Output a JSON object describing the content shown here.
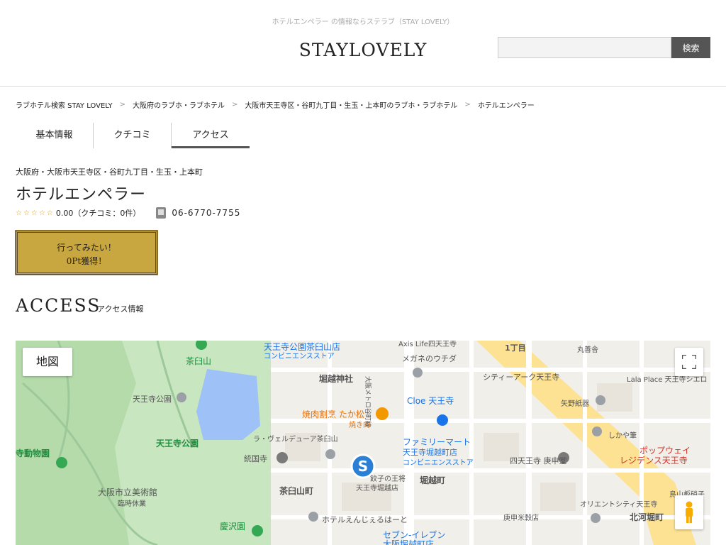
{
  "header": {
    "tagline": "ホテルエンペラー の情報ならステラブ（STAY LOVELY）",
    "logo_text": "STAYLOVELY",
    "search_placeholder": "",
    "search_button": "検索"
  },
  "breadcrumb": [
    "ラブホテル検索 STAY LOVELY",
    "大阪府のラブホ・ラブホテル",
    "大阪市天王寺区・谷町九丁目・生玉・上本町のラブホ・ラブホテル",
    "ホテルエンペラー"
  ],
  "tabs": [
    {
      "label": "基本情報",
      "active": false
    },
    {
      "label": "クチコミ",
      "active": false
    },
    {
      "label": "アクセス",
      "active": true
    }
  ],
  "hotel": {
    "area": "大阪府・大阪市天王寺区・谷町九丁目・生玉・上本町",
    "name": "ホテルエンペラー",
    "stars": "☆☆☆☆☆",
    "rating_text": "0.00（クチコミ：0件）",
    "phone": "06-6770-7755"
  },
  "want_button": {
    "line1": "行ってみたい！",
    "line2": "0Pt獲得！"
  },
  "access": {
    "title": "ACCESS",
    "subtitle": "アクセス情報"
  },
  "map": {
    "type_button": "地図",
    "labels": [
      {
        "id": "chausuyama",
        "text": "茶臼山"
      },
      {
        "id": "tennoji-park",
        "text": "天王寺公園"
      },
      {
        "id": "tennoji-park-bold",
        "text": "天王寺公園"
      },
      {
        "id": "zoo",
        "text": "寺動物園"
      },
      {
        "id": "museum",
        "text": "大阪市立美術館"
      },
      {
        "id": "museum-sub",
        "text": "臨時休業"
      },
      {
        "id": "keitakuen",
        "text": "慶沢園"
      },
      {
        "id": "convenience-top",
        "text": "天王寺公園茶臼山店"
      },
      {
        "id": "convenience-top-sub",
        "text": "コンビニエンスストア"
      },
      {
        "id": "horikoshi-shrine",
        "text": "堀越神社"
      },
      {
        "id": "yakiniku",
        "text": "焼肉割烹 たか松"
      },
      {
        "id": "yakiniku-sub",
        "text": "焼き肉"
      },
      {
        "id": "la-verdure",
        "text": "ラ・ヴェルデューア茶臼山"
      },
      {
        "id": "tokokuji",
        "text": "統国寺"
      },
      {
        "id": "chausuyama-cho",
        "text": "茶臼山町"
      },
      {
        "id": "gyoza",
        "text": "餃子の王将"
      },
      {
        "id": "gyoza-sub",
        "text": "天王寺堀越店"
      },
      {
        "id": "hotel-enjeru",
        "text": "ホテルえんじぇるはーと"
      },
      {
        "id": "seven",
        "text": "セブン-イレブン"
      },
      {
        "id": "seven-sub",
        "text": "大阪堀越町店"
      },
      {
        "id": "axis",
        "text": "Axis Life四天王寺"
      },
      {
        "id": "megane",
        "text": "メガネのウチダ"
      },
      {
        "id": "cloe",
        "text": "Cloe 天王寺"
      },
      {
        "id": "familymart",
        "text": "ファミリーマート"
      },
      {
        "id": "familymart-sub",
        "text": "天王寺堀越町店"
      },
      {
        "id": "familymart-sub2",
        "text": "コンビニエンスストア"
      },
      {
        "id": "horikoshi-cho",
        "text": "堀越町"
      },
      {
        "id": "koshindo",
        "text": "四天王寺 庚申堂"
      },
      {
        "id": "1chome",
        "text": "1丁目"
      },
      {
        "id": "marugame",
        "text": "丸善舎"
      },
      {
        "id": "city-ark",
        "text": "シティーアーク天王寺"
      },
      {
        "id": "yano",
        "text": "矢野紙器"
      },
      {
        "id": "shikaya",
        "text": "しかや筆"
      },
      {
        "id": "lalaplace",
        "text": "Lala Place 天王寺シエロ"
      },
      {
        "id": "popway",
        "text": "ポップウェイ"
      },
      {
        "id": "popway-sub",
        "text": "レジデンス天王寺"
      },
      {
        "id": "orient",
        "text": "オリエントシティ天王寺"
      },
      {
        "id": "kitakawahori",
        "text": "北河堀町"
      },
      {
        "id": "koshin-mai",
        "text": "庚申米穀店"
      },
      {
        "id": "toriyama",
        "text": "鳥山板硝子"
      },
      {
        "id": "subway",
        "text": "大阪メトロ谷町線"
      }
    ]
  }
}
